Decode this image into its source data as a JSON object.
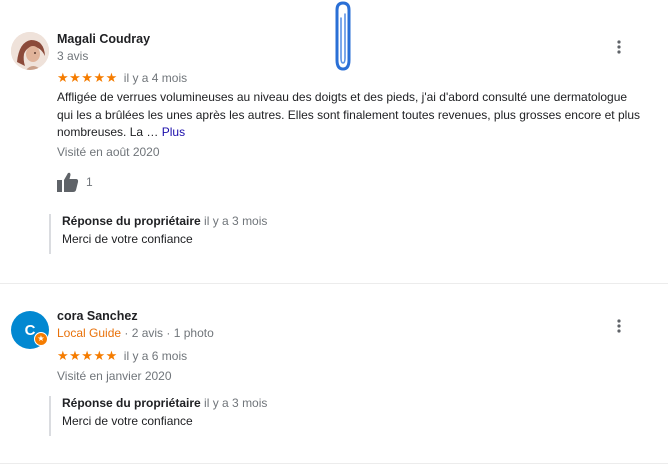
{
  "reviews": [
    {
      "author": "Magali Coudray",
      "author_meta": "3 avis",
      "stars": "★★★★★",
      "rating": 5,
      "time": "il y a 4 mois",
      "text": "Affligée de verrues volumineuses au niveau des doigts et des pieds, j'ai d'abord consulté une dermatologue qui les a brûlées les unes après les autres. Elles sont finalement toutes revenues, plus grosses encore et plus nombreuses. La …",
      "more_label": "Plus",
      "visited": "Visité en août 2020",
      "likes": "1",
      "reply": {
        "title": "Réponse du propriétaire",
        "time": "il y a 3 mois",
        "text": "Merci de votre confiance"
      }
    },
    {
      "author": "cora Sanchez",
      "avatar_letter": "C",
      "local_guide_label": "Local Guide",
      "author_meta": " · 2 avis · 1 photo",
      "stars": "★★★★★",
      "rating": 5,
      "time": "il y a 6 mois",
      "visited": "Visité en janvier 2020",
      "reply": {
        "title": "Réponse du propriétaire",
        "time": "il y a 3 mois",
        "text": "Merci de votre confiance"
      }
    }
  ],
  "colors": {
    "stars": "#f57c00",
    "local_guide": "#e8710a",
    "link": "#1a0dab",
    "avatar_c": "#0288d1",
    "clip": "#2a6fd6"
  },
  "icons": [
    "paperclip-icon",
    "more-vert-icon",
    "thumb-up-icon",
    "local-guide-badge-icon"
  ]
}
